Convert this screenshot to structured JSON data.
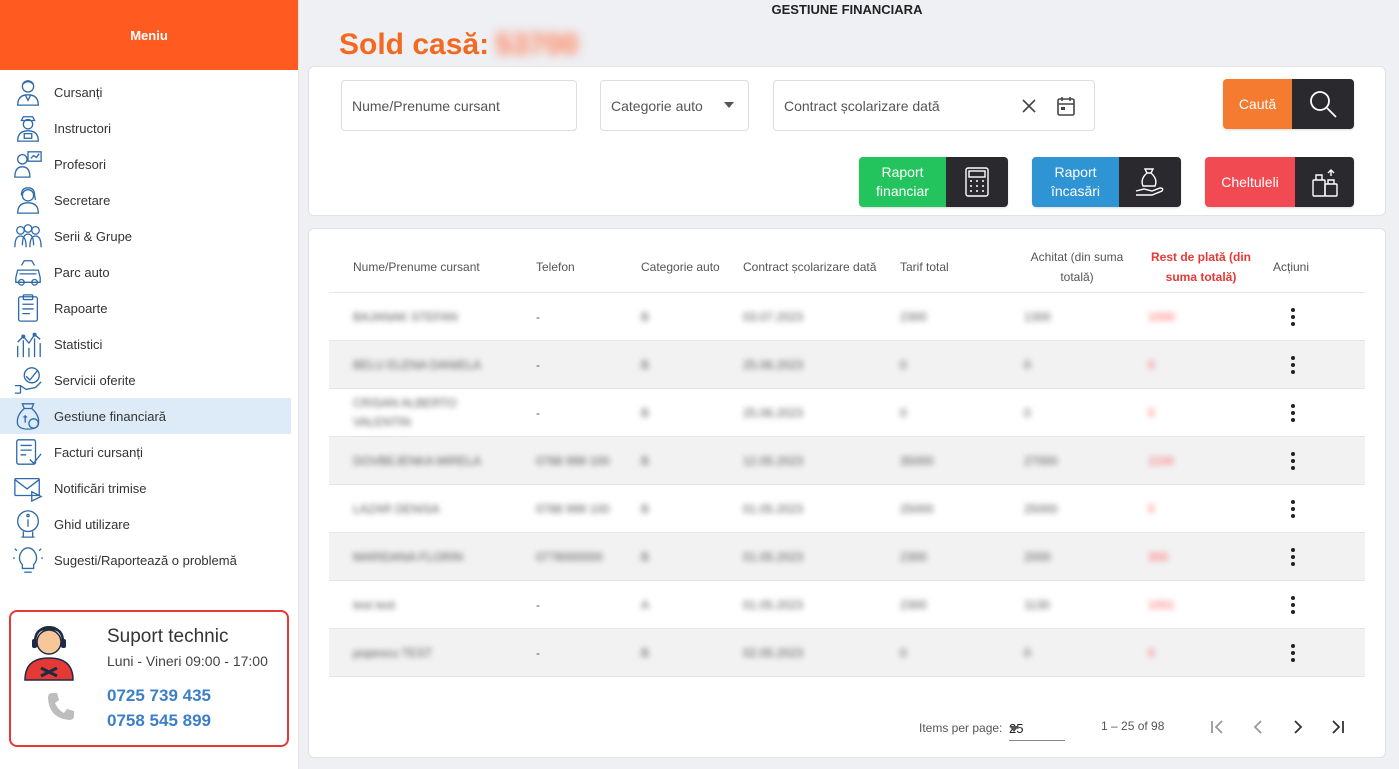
{
  "app": {
    "title": "GESTIUNE FINANCIARA",
    "sold_label": "Sold casă:",
    "sold_value": "53700"
  },
  "sidebar": {
    "header": "Meniu",
    "items": [
      {
        "label": "Cursanți",
        "icon": "student-icon"
      },
      {
        "label": "Instructori",
        "icon": "instructor-icon"
      },
      {
        "label": "Profesori",
        "icon": "teacher-icon"
      },
      {
        "label": "Secretare",
        "icon": "secretary-icon"
      },
      {
        "label": "Serii & Grupe",
        "icon": "group-icon"
      },
      {
        "label": "Parc auto",
        "icon": "car-icon"
      },
      {
        "label": "Rapoarte",
        "icon": "report-icon"
      },
      {
        "label": "Statistici",
        "icon": "statistics-icon"
      },
      {
        "label": "Servicii oferite",
        "icon": "service-icon"
      },
      {
        "label": "Gestiune financiară",
        "icon": "money-bag-icon",
        "active": true
      },
      {
        "label": "Facturi cursanți",
        "icon": "invoice-icon"
      },
      {
        "label": "Notificări trimise",
        "icon": "mail-icon"
      },
      {
        "label": "Ghid utilizare",
        "icon": "info-icon"
      },
      {
        "label": "Sugesti/Raportează o problemă",
        "icon": "lightbulb-icon"
      }
    ]
  },
  "support": {
    "title": "Suport technic",
    "hours": "Luni - Vineri 09:00 - 17:00",
    "phone1": "0725 739 435",
    "phone2": "0758 545 899"
  },
  "filters": {
    "name_placeholder": "Nume/Prenume cursant",
    "category_placeholder": "Categorie auto",
    "date_placeholder": "Contract școlarizare dată",
    "search_label": "Caută"
  },
  "actions": {
    "financial_report": "Raport financiar",
    "income_report": "Raport încasări",
    "expenses": "Cheltuleli"
  },
  "table": {
    "headers": {
      "name": "Nume/Prenume cursant",
      "phone": "Telefon",
      "category": "Categorie auto",
      "contract": "Contract școlarizare dată",
      "total": "Tarif total",
      "paid": "Achitat (din suma totală)",
      "rest": "Rest de plată (din suma totală)",
      "actions": "Acțiuni"
    },
    "rows": [
      {
        "name": "BAJANAK STEFAN",
        "phone": "-",
        "category": "B",
        "contract": "03.07.2023",
        "total": "2300",
        "paid": "1300",
        "rest": "1000"
      },
      {
        "name": "BELU ELENA DANIELA",
        "phone": "-",
        "category": "B",
        "contract": "25.06.2023",
        "total": "0",
        "paid": "0",
        "rest": "0"
      },
      {
        "name": "CRISAN ALBERTO VALENTIN",
        "phone": "-",
        "category": "B",
        "contract": "25.06.2023",
        "total": "0",
        "paid": "0",
        "rest": "0"
      },
      {
        "name": "DOVBEJENKA MIRELA",
        "phone": "0788 999 100",
        "category": "B",
        "contract": "12.05.2023",
        "total": "35000",
        "paid": "27000",
        "rest": "1100"
      },
      {
        "name": "LAZAR DENISA",
        "phone": "0788 999 100",
        "category": "B",
        "contract": "01.05.2023",
        "total": "25000",
        "paid": "25000",
        "rest": "0"
      },
      {
        "name": "MARIDANA FLORIN",
        "phone": "0778000000",
        "category": "B",
        "contract": "01.05.2023",
        "total": "2300",
        "paid": "2000",
        "rest": "300"
      },
      {
        "name": "test test",
        "phone": "-",
        "category": "A",
        "contract": "01.05.2023",
        "total": "2300",
        "paid": "1130",
        "rest": "1001"
      },
      {
        "name": "popescu TEST",
        "phone": "-",
        "category": "B",
        "contract": "02.05.2023",
        "total": "0",
        "paid": "0",
        "rest": "0"
      }
    ]
  },
  "pagination": {
    "items_label": "Items per page:",
    "per_page": "25",
    "range": "1 – 25 of 98"
  },
  "colors": {
    "sidebar_header": "#ff5a1f",
    "sold": "#f26a22",
    "search": "#f47b30",
    "financial": "#23c45e",
    "income": "#2f94d3",
    "expenses": "#f14a52",
    "rest_red": "#e53935",
    "support_border": "#e53935",
    "phone_blue": "#3d7fc7"
  }
}
